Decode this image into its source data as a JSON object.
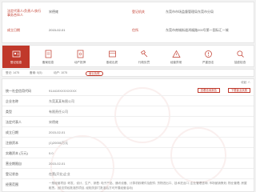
{
  "top_info": {
    "legal_rep_label": "法定代表人/负责人/执行事务合伙人",
    "legal_rep_value": "宋德雍",
    "reg_authority_label": "登记机关",
    "reg_authority_value": "东莞市市场监督管理局东莞市分局",
    "reg_date_label": "成立日期",
    "reg_date_value": "2015-02-01",
    "address_label": "住所",
    "address_value": "东莞市南城街道鸿福路200号第一国际汇一城"
  },
  "tabs": [
    {
      "label": "登记信息",
      "icon": "id-card-icon",
      "active": true
    },
    {
      "label": "备案信息",
      "icon": "document-icon",
      "active": false
    },
    {
      "label": "动产抵押",
      "icon": "stamp-icon",
      "active": false
    },
    {
      "label": "股权出质",
      "icon": "pledge-icon",
      "active": false
    },
    {
      "label": "行政处罚",
      "icon": "gavel-icon",
      "active": false
    },
    {
      "label": "经营异常",
      "icon": "warning-icon",
      "active": false
    },
    {
      "label": "严重违法",
      "icon": "alert-icon",
      "active": false
    },
    {
      "label": "抽查检查",
      "icon": "search-check-icon",
      "active": false
    }
  ],
  "filter": {
    "item1": "登记: 1475",
    "item2": "备案: 0(5)",
    "item3": "动产: 1075",
    "selected": "营业执照"
  },
  "detail": {
    "close_label": "收起 ∧",
    "rows": [
      {
        "k": "统一社会信用代码",
        "v": "914419XXXXXXXX",
        "btn": "下载营业执照",
        "btn2": "查看信用报告"
      },
      {
        "k": "企业名称",
        "v": "东莞某某有限公司"
      },
      {
        "k": "类型",
        "v": "有限责任公司"
      },
      {
        "k": "法定代表人",
        "v": "宋德雍"
      },
      {
        "k": "成立日期",
        "v": "2015-02-01"
      },
      {
        "k": "注册资本",
        "v": "(1)20000万元"
      },
      {
        "k": "实缴资本 (万元)",
        "v": "0.0"
      },
      {
        "k": "营业期限自",
        "v": "2015-02-01"
      },
      {
        "k": "营业期限至",
        "v": "0.0"
      },
      {
        "k": "核准日期",
        "v": ""
      },
      {
        "k": "登记状态",
        "v": "在营(开业)企业"
      }
    ],
    "scope_label": "经营范围",
    "scope_text": "一般经营项目: 研发、设计、生产、销售: 电子产品、通讯设备、计算机软硬件及配件; 货物进出口、技术进出口; 企业管理咨询; 市场营销策划; 物业管理; 房屋租赁。(依法须经批准的项目, 经相关部门批准后方可开展经营活动)"
  }
}
